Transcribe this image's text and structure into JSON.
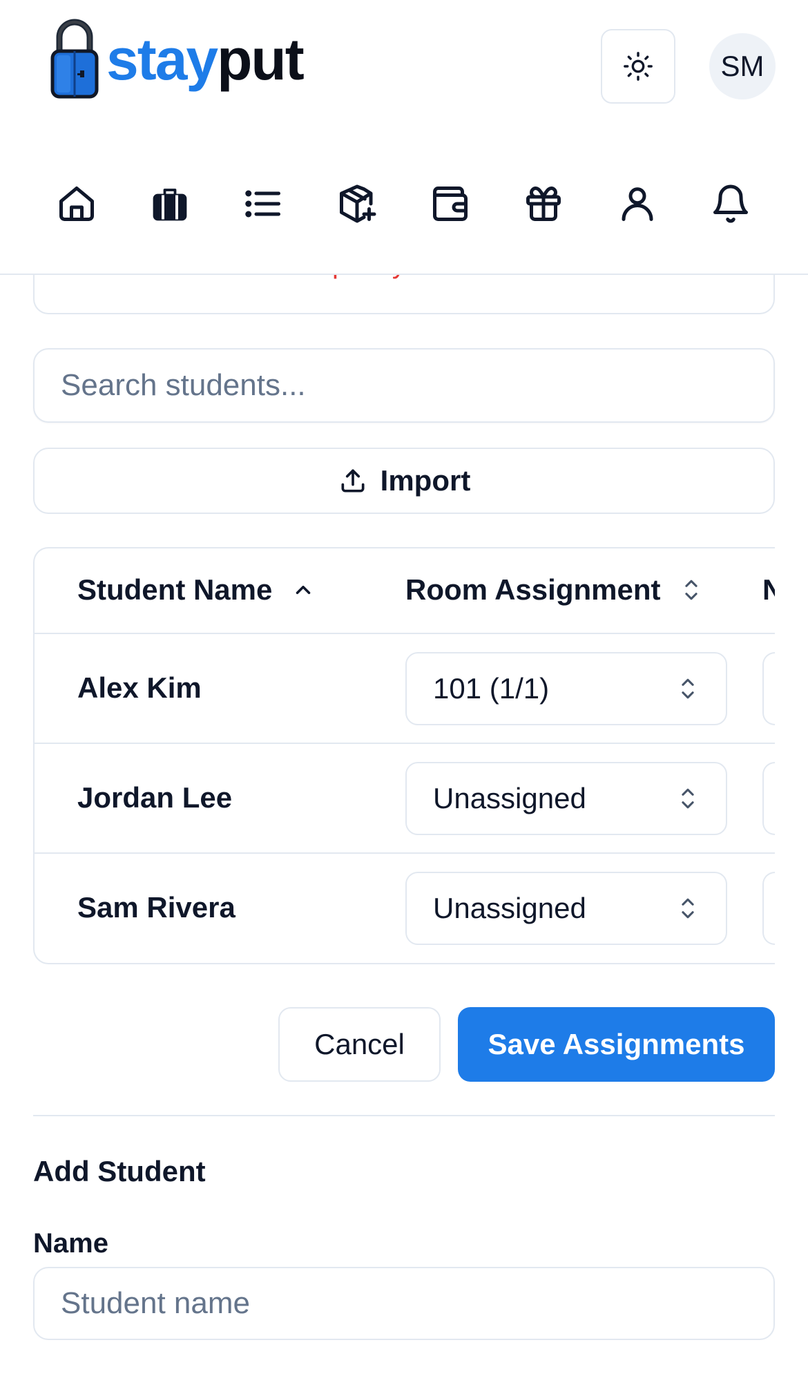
{
  "brand": {
    "name_part1": "stay",
    "name_part2": "put",
    "primary_color": "#1e7ce8"
  },
  "header": {
    "theme_toggle_icon": "sun-icon",
    "avatar_initials": "SM"
  },
  "nav": {
    "items": [
      {
        "icon": "home-icon"
      },
      {
        "icon": "luggage-icon"
      },
      {
        "icon": "list-icon"
      },
      {
        "icon": "package-plus-icon"
      },
      {
        "icon": "wallet-icon"
      },
      {
        "icon": "gift-icon"
      },
      {
        "icon": "user-icon"
      },
      {
        "icon": "bell-icon"
      }
    ]
  },
  "alert": {
    "text": "increase room occupancy.",
    "color": "#e53935"
  },
  "search": {
    "placeholder": "Search students..."
  },
  "import": {
    "label": "Import"
  },
  "table": {
    "columns": [
      {
        "label": "Student Name",
        "sort": "ascending"
      },
      {
        "label": "Room Assignment",
        "sort": "none"
      },
      {
        "label": "N"
      }
    ],
    "rows": [
      {
        "name": "Alex Kim",
        "room": "101 (1/1)"
      },
      {
        "name": "Jordan Lee",
        "room": "Unassigned"
      },
      {
        "name": "Sam Rivera",
        "room": "Unassigned"
      }
    ]
  },
  "actions": {
    "cancel_label": "Cancel",
    "save_label": "Save Assignments"
  },
  "add_student": {
    "title": "Add Student",
    "name_label": "Name",
    "name_placeholder": "Student name"
  }
}
